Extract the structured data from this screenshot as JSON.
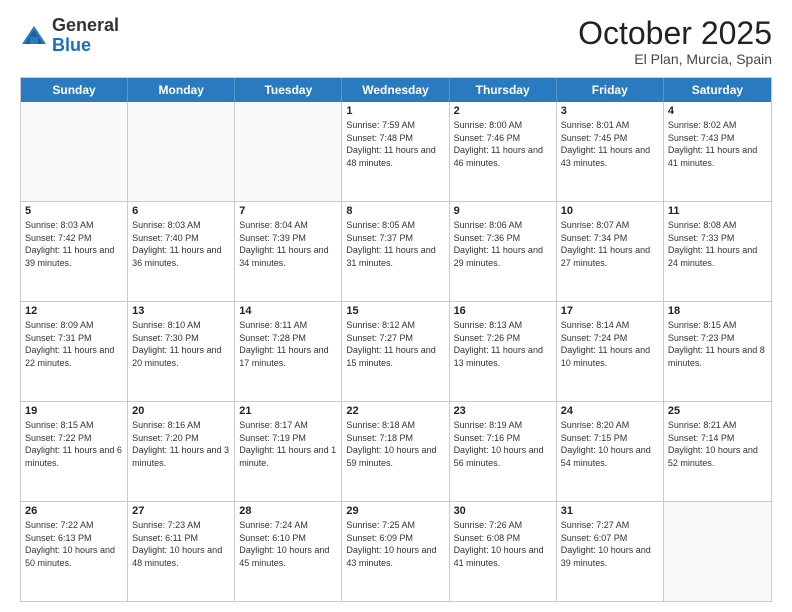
{
  "logo": {
    "general": "General",
    "blue": "Blue"
  },
  "header": {
    "month": "October 2025",
    "location": "El Plan, Murcia, Spain"
  },
  "weekdays": [
    "Sunday",
    "Monday",
    "Tuesday",
    "Wednesday",
    "Thursday",
    "Friday",
    "Saturday"
  ],
  "weeks": [
    [
      {
        "day": "",
        "sunrise": "",
        "sunset": "",
        "daylight": ""
      },
      {
        "day": "",
        "sunrise": "",
        "sunset": "",
        "daylight": ""
      },
      {
        "day": "",
        "sunrise": "",
        "sunset": "",
        "daylight": ""
      },
      {
        "day": "1",
        "sunrise": "Sunrise: 7:59 AM",
        "sunset": "Sunset: 7:48 PM",
        "daylight": "Daylight: 11 hours and 48 minutes."
      },
      {
        "day": "2",
        "sunrise": "Sunrise: 8:00 AM",
        "sunset": "Sunset: 7:46 PM",
        "daylight": "Daylight: 11 hours and 46 minutes."
      },
      {
        "day": "3",
        "sunrise": "Sunrise: 8:01 AM",
        "sunset": "Sunset: 7:45 PM",
        "daylight": "Daylight: 11 hours and 43 minutes."
      },
      {
        "day": "4",
        "sunrise": "Sunrise: 8:02 AM",
        "sunset": "Sunset: 7:43 PM",
        "daylight": "Daylight: 11 hours and 41 minutes."
      }
    ],
    [
      {
        "day": "5",
        "sunrise": "Sunrise: 8:03 AM",
        "sunset": "Sunset: 7:42 PM",
        "daylight": "Daylight: 11 hours and 39 minutes."
      },
      {
        "day": "6",
        "sunrise": "Sunrise: 8:03 AM",
        "sunset": "Sunset: 7:40 PM",
        "daylight": "Daylight: 11 hours and 36 minutes."
      },
      {
        "day": "7",
        "sunrise": "Sunrise: 8:04 AM",
        "sunset": "Sunset: 7:39 PM",
        "daylight": "Daylight: 11 hours and 34 minutes."
      },
      {
        "day": "8",
        "sunrise": "Sunrise: 8:05 AM",
        "sunset": "Sunset: 7:37 PM",
        "daylight": "Daylight: 11 hours and 31 minutes."
      },
      {
        "day": "9",
        "sunrise": "Sunrise: 8:06 AM",
        "sunset": "Sunset: 7:36 PM",
        "daylight": "Daylight: 11 hours and 29 minutes."
      },
      {
        "day": "10",
        "sunrise": "Sunrise: 8:07 AM",
        "sunset": "Sunset: 7:34 PM",
        "daylight": "Daylight: 11 hours and 27 minutes."
      },
      {
        "day": "11",
        "sunrise": "Sunrise: 8:08 AM",
        "sunset": "Sunset: 7:33 PM",
        "daylight": "Daylight: 11 hours and 24 minutes."
      }
    ],
    [
      {
        "day": "12",
        "sunrise": "Sunrise: 8:09 AM",
        "sunset": "Sunset: 7:31 PM",
        "daylight": "Daylight: 11 hours and 22 minutes."
      },
      {
        "day": "13",
        "sunrise": "Sunrise: 8:10 AM",
        "sunset": "Sunset: 7:30 PM",
        "daylight": "Daylight: 11 hours and 20 minutes."
      },
      {
        "day": "14",
        "sunrise": "Sunrise: 8:11 AM",
        "sunset": "Sunset: 7:28 PM",
        "daylight": "Daylight: 11 hours and 17 minutes."
      },
      {
        "day": "15",
        "sunrise": "Sunrise: 8:12 AM",
        "sunset": "Sunset: 7:27 PM",
        "daylight": "Daylight: 11 hours and 15 minutes."
      },
      {
        "day": "16",
        "sunrise": "Sunrise: 8:13 AM",
        "sunset": "Sunset: 7:26 PM",
        "daylight": "Daylight: 11 hours and 13 minutes."
      },
      {
        "day": "17",
        "sunrise": "Sunrise: 8:14 AM",
        "sunset": "Sunset: 7:24 PM",
        "daylight": "Daylight: 11 hours and 10 minutes."
      },
      {
        "day": "18",
        "sunrise": "Sunrise: 8:15 AM",
        "sunset": "Sunset: 7:23 PM",
        "daylight": "Daylight: 11 hours and 8 minutes."
      }
    ],
    [
      {
        "day": "19",
        "sunrise": "Sunrise: 8:15 AM",
        "sunset": "Sunset: 7:22 PM",
        "daylight": "Daylight: 11 hours and 6 minutes."
      },
      {
        "day": "20",
        "sunrise": "Sunrise: 8:16 AM",
        "sunset": "Sunset: 7:20 PM",
        "daylight": "Daylight: 11 hours and 3 minutes."
      },
      {
        "day": "21",
        "sunrise": "Sunrise: 8:17 AM",
        "sunset": "Sunset: 7:19 PM",
        "daylight": "Daylight: 11 hours and 1 minute."
      },
      {
        "day": "22",
        "sunrise": "Sunrise: 8:18 AM",
        "sunset": "Sunset: 7:18 PM",
        "daylight": "Daylight: 10 hours and 59 minutes."
      },
      {
        "day": "23",
        "sunrise": "Sunrise: 8:19 AM",
        "sunset": "Sunset: 7:16 PM",
        "daylight": "Daylight: 10 hours and 56 minutes."
      },
      {
        "day": "24",
        "sunrise": "Sunrise: 8:20 AM",
        "sunset": "Sunset: 7:15 PM",
        "daylight": "Daylight: 10 hours and 54 minutes."
      },
      {
        "day": "25",
        "sunrise": "Sunrise: 8:21 AM",
        "sunset": "Sunset: 7:14 PM",
        "daylight": "Daylight: 10 hours and 52 minutes."
      }
    ],
    [
      {
        "day": "26",
        "sunrise": "Sunrise: 7:22 AM",
        "sunset": "Sunset: 6:13 PM",
        "daylight": "Daylight: 10 hours and 50 minutes."
      },
      {
        "day": "27",
        "sunrise": "Sunrise: 7:23 AM",
        "sunset": "Sunset: 6:11 PM",
        "daylight": "Daylight: 10 hours and 48 minutes."
      },
      {
        "day": "28",
        "sunrise": "Sunrise: 7:24 AM",
        "sunset": "Sunset: 6:10 PM",
        "daylight": "Daylight: 10 hours and 45 minutes."
      },
      {
        "day": "29",
        "sunrise": "Sunrise: 7:25 AM",
        "sunset": "Sunset: 6:09 PM",
        "daylight": "Daylight: 10 hours and 43 minutes."
      },
      {
        "day": "30",
        "sunrise": "Sunrise: 7:26 AM",
        "sunset": "Sunset: 6:08 PM",
        "daylight": "Daylight: 10 hours and 41 minutes."
      },
      {
        "day": "31",
        "sunrise": "Sunrise: 7:27 AM",
        "sunset": "Sunset: 6:07 PM",
        "daylight": "Daylight: 10 hours and 39 minutes."
      },
      {
        "day": "",
        "sunrise": "",
        "sunset": "",
        "daylight": ""
      }
    ]
  ]
}
